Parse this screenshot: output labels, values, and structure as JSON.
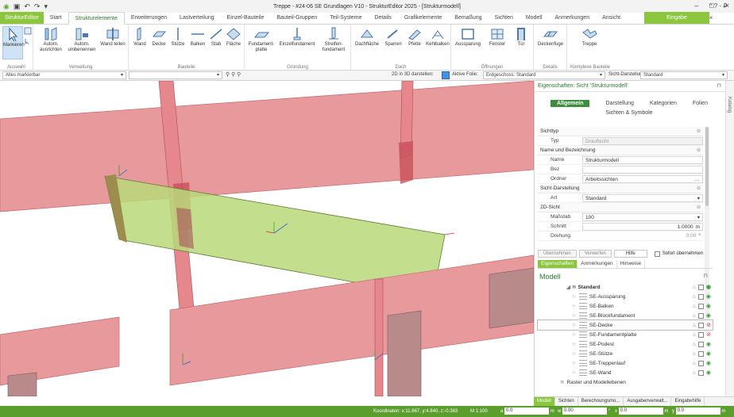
{
  "window": {
    "title": "Treppe - #24-06 SE Grundlagen V10 - StrukturEditor 2025 - [Strukturmodell]",
    "controls": {
      "minimize": "–",
      "maximize": "□",
      "close": "×"
    }
  },
  "tabs": {
    "app": "StrukturEditor",
    "items": [
      "Start",
      "Strukturelemente",
      "Erweiterungen",
      "Lastverteilung",
      "Einzel-Bauteile",
      "Bauteil-Gruppen",
      "Teil-Systeme",
      "Details",
      "Grafikelemente",
      "Bemaßung",
      "Sichten",
      "Modell",
      "Anmerkungen",
      "Ansicht"
    ],
    "contextual": "Eingabe",
    "help": "^ ? - ₽ ×"
  },
  "ribbon": {
    "groups": {
      "auswahl": {
        "label": "Auswahl",
        "buttons": [
          "Markieren"
        ]
      },
      "verwaltung": {
        "label": "Verwaltung",
        "buttons": [
          "Autom. ausrichten",
          "Autom. umbenennen",
          "Wand teilen"
        ]
      },
      "bauteile": {
        "label": "Bauteile",
        "buttons": [
          "Wand",
          "Decke",
          "Stütze",
          "Balken",
          "Stab",
          "Fläche"
        ]
      },
      "gruendung": {
        "label": "Gründung",
        "buttons": [
          "Fundament-platte",
          "Einzelfundament",
          "Streifen-fundament"
        ]
      },
      "dach": {
        "label": "Dach",
        "buttons": [
          "Dachfläche",
          "Sparren",
          "Pfette",
          "Kehlbalken"
        ]
      },
      "oeffnungen": {
        "label": "Öffnungen",
        "buttons": [
          "Aussparung",
          "Fenster",
          "Tür"
        ]
      },
      "details": {
        "label": "Details",
        "buttons": [
          "Deckenfuge"
        ]
      },
      "komplexe": {
        "label": "Komplexe Bauteile",
        "buttons": [
          "Treppe"
        ]
      }
    }
  },
  "optionbar": {
    "filter": "Alles markierbar",
    "display_2d_in_3d": "2D in 3D darstellen:",
    "active_layer_label": "Aktive Folie:",
    "active_layer": "Erdgeschoss: Standard",
    "view_display_label": "Sicht-Darstellung:",
    "view_display": "Standard"
  },
  "properties": {
    "header": "Eigenschaften: Sicht 'Strukturmodell'",
    "tabs": [
      "Allgemein",
      "Darstellung",
      "Kategorien",
      "Folien",
      "Sichten & Symbole"
    ],
    "sections": [
      {
        "title": "Sichttyp",
        "rows": [
          {
            "key": "Typ",
            "value": "Draufsicht",
            "disabled": true
          }
        ]
      },
      {
        "title": "Name und Bezeichnung",
        "rows": [
          {
            "key": "Name",
            "value": "Strukturmodell"
          },
          {
            "key": "Bez",
            "value": ""
          },
          {
            "key": "Ordner",
            "value": "Arbeitssichten"
          }
        ]
      },
      {
        "title": "Sicht-Darstellung",
        "rows": [
          {
            "key": "Art",
            "value": "Standard"
          }
        ]
      },
      {
        "title": "2D-Sicht",
        "rows": [
          {
            "key": "Maßstab",
            "value": "100"
          },
          {
            "key": "Schnitt",
            "value": "1.0000",
            "unit": "m"
          },
          {
            "key": "Drehung",
            "value": "0.00",
            "unit": "°",
            "disabled": true
          }
        ]
      }
    ],
    "buttons": {
      "apply": "Übernehmen",
      "discard": "Verwerfen",
      "help": "Hilfe",
      "instant": "Sofort übernehmen"
    },
    "subtabs": [
      "Eigenschaften",
      "Anmerkungen",
      "Hinweise"
    ]
  },
  "model": {
    "title": "Modell",
    "root": "Standard",
    "items": [
      {
        "label": "SE-Aussparung",
        "visible": true
      },
      {
        "label": "SE-Balken",
        "visible": true
      },
      {
        "label": "SE-Blockfundament",
        "visible": true
      },
      {
        "label": "SE-Decke",
        "visible": false
      },
      {
        "label": "SE-Fundamentplatte",
        "visible": false
      },
      {
        "label": "SE-Podest",
        "visible": true
      },
      {
        "label": "SE-Stütze",
        "visible": true
      },
      {
        "label": "SE-Treppenlauf",
        "visible": true
      },
      {
        "label": "SE-Wand",
        "visible": true
      }
    ],
    "extra": "Raster und Modellebenen"
  },
  "bottom_tabs": [
    "Modell",
    "Sichten",
    "Berechnungsmo...",
    "Ausgabenverwalt...",
    "Eingabehilfe"
  ],
  "side_tab": "Katalog",
  "status": {
    "coords": "Koordinaten: x:11.667, y:4.840, z:-0.383",
    "scale": "M 1:100",
    "fields": [
      {
        "label": "a",
        "value": "0.0",
        "unit": "m"
      },
      {
        "label": "w",
        "value": "0.00",
        "unit": "°"
      },
      {
        "label": "x",
        "value": "0.0",
        "unit": "m"
      },
      {
        "label": "y",
        "value": "0.0",
        "unit": "m"
      }
    ]
  },
  "colors": {
    "accent": "#8cc63f",
    "dark_accent": "#3e8e3e",
    "wall": "#e8999c",
    "slab": "#b9d97a"
  }
}
